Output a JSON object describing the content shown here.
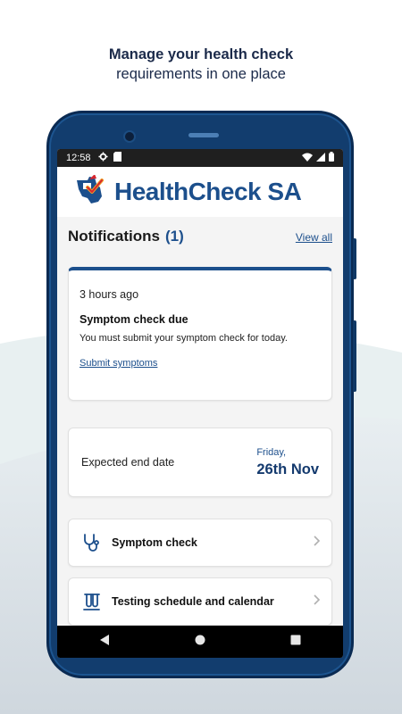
{
  "promo": {
    "line1": "Manage your health check",
    "line2": "requirements in one place"
  },
  "status_bar": {
    "time": "12:58",
    "icons": [
      "gear-icon",
      "sd-card-icon",
      "wifi-icon",
      "signal-icon",
      "battery-icon"
    ]
  },
  "app": {
    "brand_name": "HealthCheck SA",
    "logo_icon": "sa-map-checkmark-logo"
  },
  "notifications": {
    "title": "Notifications",
    "count": "(1)",
    "view_all": "View all",
    "card": {
      "time": "3 hours ago",
      "title": "Symptom check due",
      "body": "You must submit your symptom check for today.",
      "link": "Submit symptoms"
    }
  },
  "end_date": {
    "label": "Expected end date",
    "day": "Friday,",
    "date": "26th Nov"
  },
  "menu": {
    "items": [
      {
        "label": "Symptom check",
        "icon": "stethoscope-icon"
      },
      {
        "label": "Testing schedule and calendar",
        "icon": "test-tubes-icon"
      }
    ]
  },
  "nav": {
    "icons": [
      "back-icon",
      "home-icon",
      "recents-icon"
    ]
  },
  "colors": {
    "brand_blue": "#1c4f8c",
    "phone_frame": "#123d6e",
    "logo_red": "#d7262f"
  }
}
